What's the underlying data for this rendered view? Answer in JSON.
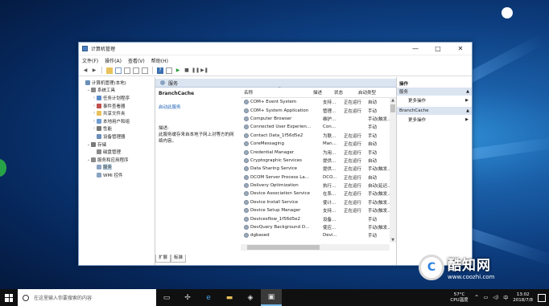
{
  "window": {
    "title": "计算机管理",
    "controls": [
      "—",
      "□",
      "✕"
    ]
  },
  "menubar": [
    "文件(F)",
    "操作(A)",
    "查看(V)",
    "帮助(H)"
  ],
  "tree": [
    {
      "label": "计算机管理(本地)",
      "level": 0,
      "exp": "",
      "icon": "computer-icon",
      "color": "#6a8fb8"
    },
    {
      "label": "系统工具",
      "level": 1,
      "exp": "⌄",
      "icon": "tools-icon",
      "color": "#8a8a8a"
    },
    {
      "label": "任务计划程序",
      "level": 2,
      "exp": "›",
      "icon": "clock-icon",
      "color": "#5b8bc9"
    },
    {
      "label": "事件查看器",
      "level": 2,
      "exp": "›",
      "icon": "event-viewer-icon",
      "color": "#c0504d"
    },
    {
      "label": "共享文件夹",
      "level": 2,
      "exp": "›",
      "icon": "folder-icon",
      "color": "#e8c15a"
    },
    {
      "label": "本地用户和组",
      "level": 2,
      "exp": "›",
      "icon": "users-icon",
      "color": "#6e9bd1"
    },
    {
      "label": "性能",
      "level": 2,
      "exp": "›",
      "icon": "performance-icon",
      "color": "#777"
    },
    {
      "label": "设备管理器",
      "level": 2,
      "exp": "",
      "icon": "device-manager-icon",
      "color": "#6a8fb8"
    },
    {
      "label": "存储",
      "level": 1,
      "exp": "⌄",
      "icon": "storage-icon",
      "color": "#7a7a7a"
    },
    {
      "label": "磁盘管理",
      "level": 2,
      "exp": "",
      "icon": "disk-icon",
      "color": "#8a8a8a"
    },
    {
      "label": "服务和应用程序",
      "level": 1,
      "exp": "⌄",
      "icon": "apps-icon",
      "color": "#8a8a8a"
    },
    {
      "label": "服务",
      "level": 2,
      "exp": "",
      "icon": "services-icon",
      "color": "#8aa3c2",
      "selected": true
    },
    {
      "label": "WMI 控件",
      "level": 2,
      "exp": "",
      "icon": "wmi-icon",
      "color": "#8aa3c2"
    }
  ],
  "services_header": "服务",
  "detail": {
    "name": "BranchCache",
    "link": "启动此服务",
    "desc_label": "描述:",
    "desc": "此服务缓存来自本地子网上对等方的网络内容。"
  },
  "columns": {
    "name": "名称",
    "desc": "描述",
    "state": "状态",
    "start": "启动类型"
  },
  "services": [
    {
      "name": "COM+ Event System",
      "desc": "支持...",
      "state": "正在运行",
      "start": "自动"
    },
    {
      "name": "COM+ System Application",
      "desc": "管理...",
      "state": "正在运行",
      "start": "手动"
    },
    {
      "name": "Computer Browser",
      "desc": "维护...",
      "state": "",
      "start": "手动(触发..."
    },
    {
      "name": "Connected User Experien...",
      "desc": "Con...",
      "state": "",
      "start": "手动"
    },
    {
      "name": "Contact Data_1f56d5e2",
      "desc": "为联...",
      "state": "正在运行",
      "start": "手动"
    },
    {
      "name": "CoreMessaging",
      "desc": "Man...",
      "state": "正在运行",
      "start": "自动"
    },
    {
      "name": "Credential Manager",
      "desc": "为用...",
      "state": "正在运行",
      "start": "手动"
    },
    {
      "name": "Cryptographic Services",
      "desc": "提供...",
      "state": "正在运行",
      "start": "自动"
    },
    {
      "name": "Data Sharing Service",
      "desc": "提供...",
      "state": "正在运行",
      "start": "手动(触发..."
    },
    {
      "name": "DCOM Server Process La...",
      "desc": "DCO...",
      "state": "正在运行",
      "start": "自动"
    },
    {
      "name": "Delivery Optimization",
      "desc": "执行...",
      "state": "正在运行",
      "start": "自动(延迟..."
    },
    {
      "name": "Device Association Service",
      "desc": "在系...",
      "state": "正在运行",
      "start": "手动(触发..."
    },
    {
      "name": "Device Install Service",
      "desc": "使计...",
      "state": "正在运行",
      "start": "手动(触发..."
    },
    {
      "name": "Device Setup Manager",
      "desc": "支持...",
      "state": "正在运行",
      "start": "手动(触发..."
    },
    {
      "name": "Devicesflow_1f56d5e2",
      "desc": "设备...",
      "state": "",
      "start": "手动"
    },
    {
      "name": "DevQuery Background D...",
      "desc": "使应...",
      "state": "",
      "start": "手动(触发..."
    },
    {
      "name": "dgbased",
      "desc": "Devi...",
      "state": "",
      "start": "手动"
    }
  ],
  "bottom_tabs": [
    "扩展",
    "标准"
  ],
  "actions": {
    "title": "操作",
    "sections": [
      {
        "label": "服务",
        "item": "更多操作"
      },
      {
        "label": "BranchCache",
        "item": "更多操作"
      }
    ]
  },
  "watermark": {
    "logo": "C",
    "name": "酷知网",
    "url": "www.coozhi.com"
  },
  "taskbar": {
    "search_placeholder": "在这里输入你要搜索的内容",
    "cpu_temp": "57°C",
    "cpu_label": "CPU温度",
    "lang": "中",
    "time": "13:02",
    "date": "2018/7/8"
  }
}
